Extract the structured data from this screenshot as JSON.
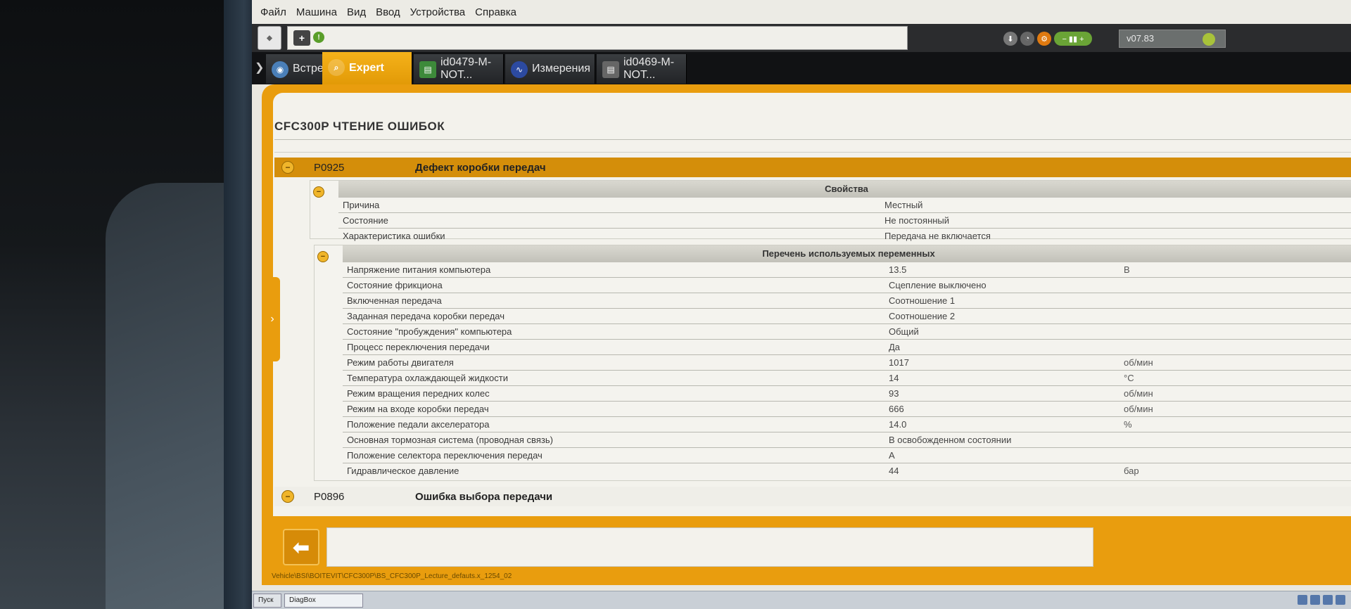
{
  "menu": [
    "Файл",
    "Машина",
    "Вид",
    "Ввод",
    "Устройства",
    "Справка"
  ],
  "toolbar": {
    "version": "v07.83"
  },
  "tabs": [
    {
      "label": "Встреча",
      "icon": "meeting-icon",
      "active": false
    },
    {
      "label": "Expert",
      "icon": "magnifier-icon",
      "active": true
    },
    {
      "label": "id0479-M-NOT...",
      "icon": "document-icon",
      "active": false
    },
    {
      "label": "Измерения",
      "icon": "waveform-icon",
      "active": false
    },
    {
      "label": "id0469-M-NOT...",
      "icon": "document-icon",
      "active": false
    }
  ],
  "page": {
    "title": "CFC300P  ЧТЕНИЕ ОШИБОК"
  },
  "faults": [
    {
      "code": "P0925",
      "description": "Дефект коробки передач"
    },
    {
      "code": "P0896",
      "description": "Ошибка выбора передачи"
    }
  ],
  "properties": {
    "header": "Свойства",
    "rows": [
      {
        "name": "Причина",
        "value": "Местный"
      },
      {
        "name": "Состояние",
        "value": "Не постоянный"
      },
      {
        "name": "Характеристика ошибки",
        "value": "Передача не включается"
      }
    ]
  },
  "variables": {
    "header": "Перечень используемых переменных",
    "rows": [
      {
        "name": "Напряжение питания компьютера",
        "value": "13.5",
        "unit": "В"
      },
      {
        "name": "Состояние фрикциона",
        "value": "Сцепление выключено",
        "unit": ""
      },
      {
        "name": "Включенная передача",
        "value": "Соотношение 1",
        "unit": ""
      },
      {
        "name": "Заданная передача коробки передач",
        "value": "Соотношение 2",
        "unit": ""
      },
      {
        "name": "Состояние \"пробуждения\" компьютера",
        "value": "Общий",
        "unit": ""
      },
      {
        "name": "Процесс переключения передачи",
        "value": "Да",
        "unit": ""
      },
      {
        "name": "Режим работы двигателя",
        "value": "1017",
        "unit": "об/мин"
      },
      {
        "name": "Температура охлаждающей жидкости",
        "value": "14",
        "unit": "°C"
      },
      {
        "name": "Режим вращения передних колес",
        "value": "93",
        "unit": "об/мин"
      },
      {
        "name": "Режим на входе коробки передач",
        "value": "666",
        "unit": "об/мин"
      },
      {
        "name": "Положение педали акселератора",
        "value": "14.0",
        "unit": "%"
      },
      {
        "name": "Основная тормозная система (проводная связь)",
        "value": "В освобожденном состоянии",
        "unit": ""
      },
      {
        "name": "Положение селектора переключения передач",
        "value": "A",
        "unit": ""
      },
      {
        "name": "Гидравлическое давление",
        "value": "44",
        "unit": "бар"
      }
    ]
  },
  "status_path": "Vehicle\\BSI\\BOITEVIT\\CFC300P\\BS_CFC300P_Lecture_defauts.x_1254_02",
  "taskbar": {
    "start": "Пуск",
    "item": "DiagBox"
  },
  "colors": {
    "accent": "#e99d0e",
    "fault_row": "#d48e0a"
  }
}
